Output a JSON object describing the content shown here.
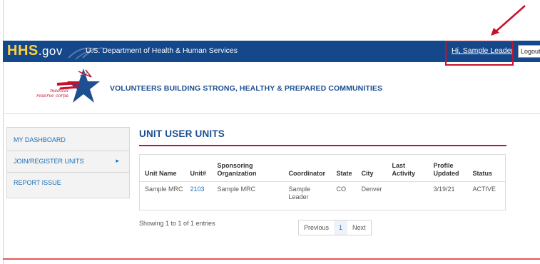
{
  "hhs_bar": {
    "logo_main": "HHS",
    "logo_suffix": ".gov",
    "department": "U.S. Department of Health & Human Services",
    "greeting": "Hi, Sample Leader",
    "logout_label": "Logout"
  },
  "header": {
    "logo_text": "medical reserve corps",
    "tagline": "VOLUNTEERS BUILDING STRONG, HEALTHY & PREPARED COMMUNITIES"
  },
  "sidebar": {
    "items": [
      {
        "label": "MY DASHBOARD"
      },
      {
        "label": "JOIN/REGISTER UNITS",
        "chevron": "▸"
      },
      {
        "label": "REPORT ISSUE"
      }
    ]
  },
  "main": {
    "title": "UNIT USER UNITS",
    "columns": [
      "Unit Name",
      "Unit#",
      "Sponsoring Organization",
      "Coordinator",
      "State",
      "City",
      "Last Activity",
      "Profile Updated",
      "Status"
    ],
    "rows": [
      {
        "unit_name": "Sample MRC",
        "unit_number": "2103",
        "sponsoring_org": "Sample MRC",
        "coordinator": "Sample Leader",
        "state": "CO",
        "city": "Denver",
        "last_activity": "",
        "profile_updated": "3/19/21",
        "status": "ACTIVE"
      }
    ],
    "showing": "Showing 1 to 1 of 1 entries",
    "pager": {
      "previous": "Previous",
      "current": "1",
      "next": "Next"
    }
  },
  "colors": {
    "hhs_blue": "#14488a",
    "mrc_blue": "#1d4f91",
    "link_blue": "#1d6fb8",
    "annotation_red": "#c8102e"
  }
}
